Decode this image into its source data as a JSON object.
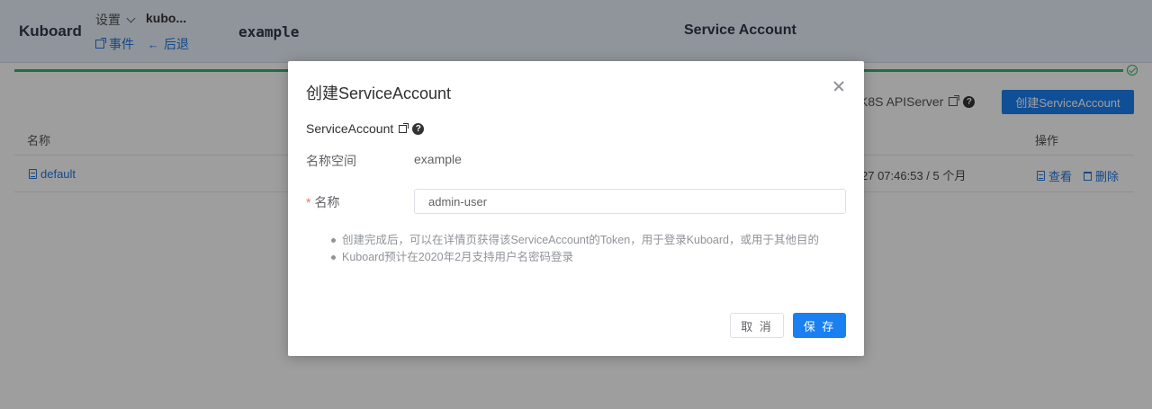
{
  "header": {
    "brand": "Kuboard",
    "settings_label": "设置",
    "cluster_name": "kubo...",
    "events_label": "事件",
    "back_label": "后退",
    "namespace": "example",
    "page_title": "Service Account"
  },
  "toolbar": {
    "api_link_label": "K8S APIServer",
    "create_button_label": "创建ServiceAccount"
  },
  "table": {
    "columns": {
      "name": "名称",
      "operations": "操作"
    },
    "rows": [
      {
        "name": "default",
        "time": "27 07:46:53 / 5 个月",
        "view_label": "查看",
        "delete_label": "删除"
      }
    ]
  },
  "modal": {
    "title": "创建ServiceAccount",
    "section_label": "ServiceAccount",
    "namespace_label": "名称空间",
    "namespace_value": "example",
    "required_mark": "*",
    "name_label": "名称",
    "name_value": "admin-user",
    "tips": [
      "创建完成后，可以在详情页获得该ServiceAccount的Token，用于登录Kuboard，或用于其他目的",
      "Kuboard预计在2020年2月支持用户名密码登录"
    ],
    "cancel_label": "取 消",
    "save_label": "保 存"
  },
  "colors": {
    "accent": "#1a7ff0",
    "link": "#2277dd",
    "progress": "#34b36a",
    "header_bg": "#e8f0fa"
  }
}
